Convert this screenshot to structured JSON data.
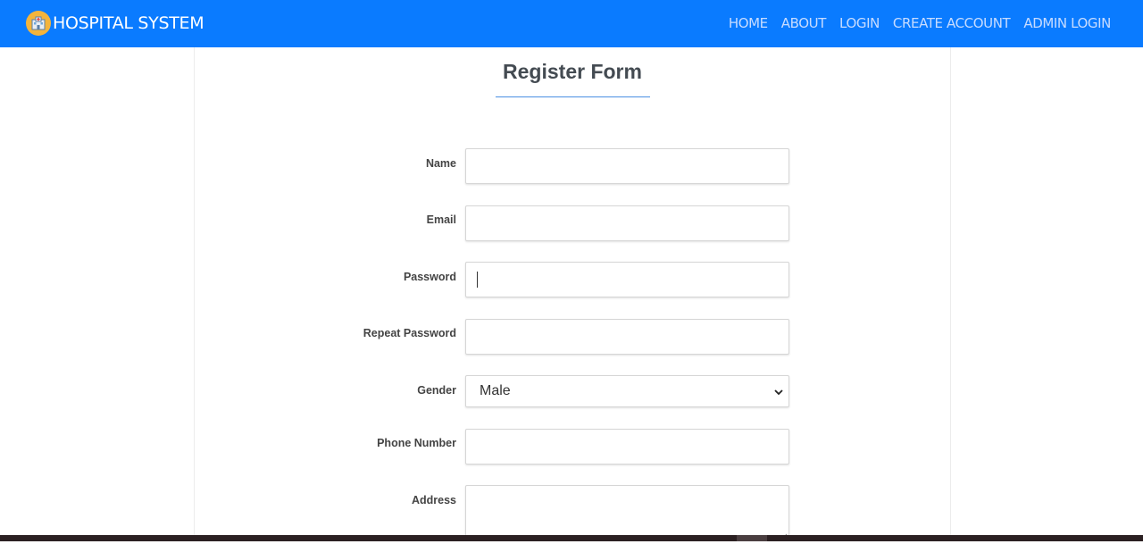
{
  "navbar": {
    "brand": "HOSPITAL SYSTEM",
    "brand_icon": "hospital-icon",
    "background": "#0a7bff",
    "links": [
      "HOME",
      "ABOUT",
      "LOGIN",
      "CREATE ACCOUNT",
      "ADMIN LOGIN"
    ]
  },
  "form": {
    "title": "Register Form",
    "fields": {
      "name": {
        "label": "Name",
        "value": "",
        "placeholder": ""
      },
      "email": {
        "label": "Email",
        "value": "",
        "placeholder": ""
      },
      "password": {
        "label": "Password",
        "value": "",
        "placeholder": ""
      },
      "repeat_password": {
        "label": "Repeat Password",
        "value": "",
        "placeholder": ""
      },
      "gender": {
        "label": "Gender",
        "value": "Male"
      },
      "phone": {
        "label": "Phone Number",
        "value": "",
        "placeholder": ""
      },
      "address": {
        "label": "Address",
        "value": ""
      }
    }
  }
}
